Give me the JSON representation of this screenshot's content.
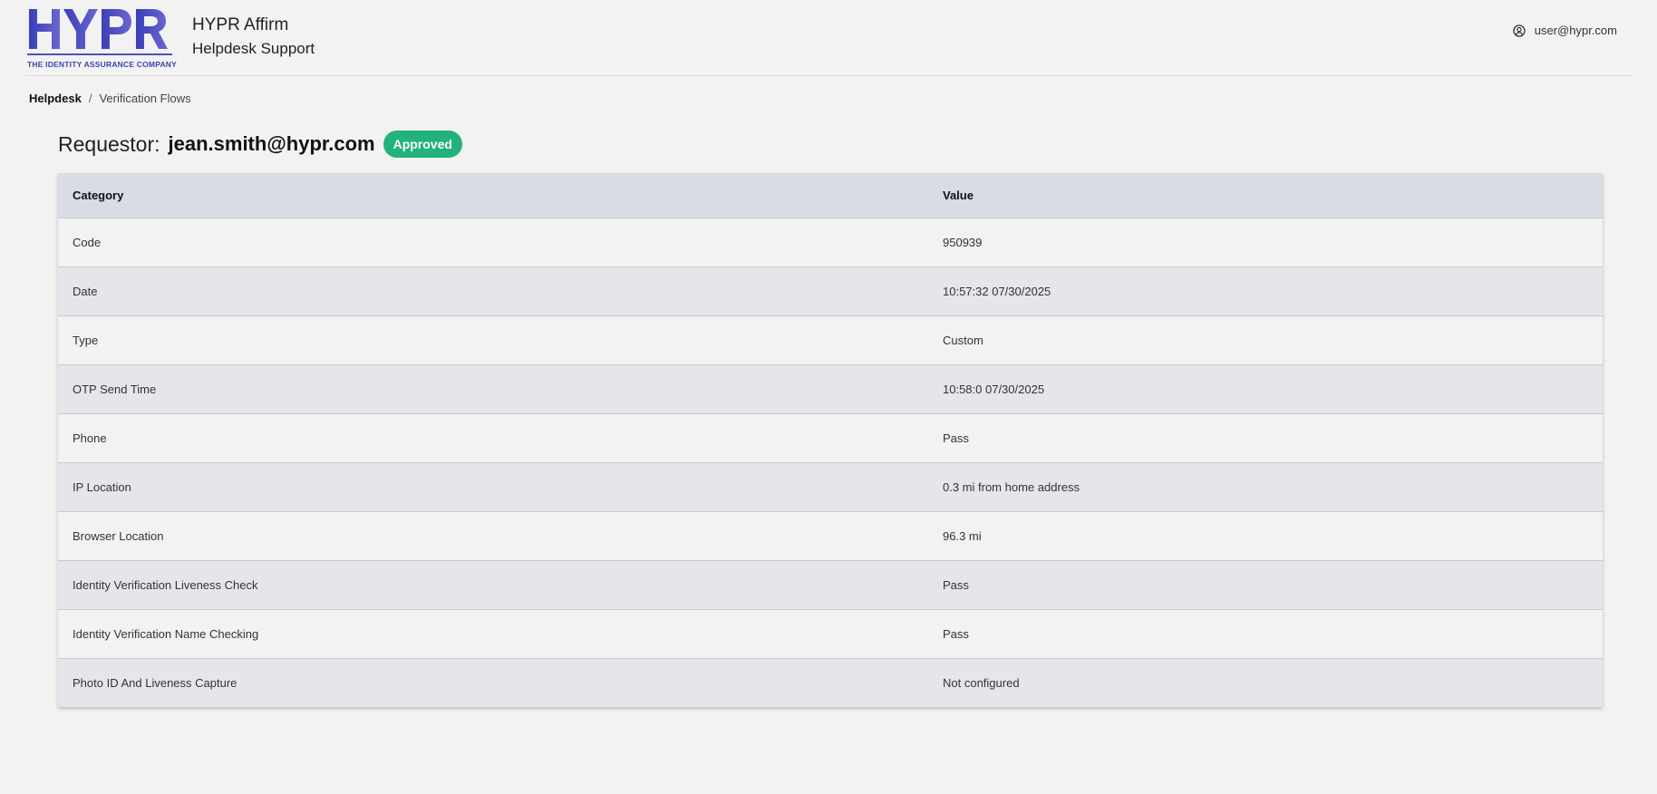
{
  "header": {
    "logo_text": "HYPR",
    "logo_tagline": "THE IDENTITY ASSURANCE COMPANY",
    "app_title": "HYPR Affirm",
    "app_subtitle": "Helpdesk Support",
    "user_email": "user@hypr.com",
    "brand_color": "#4a52c0"
  },
  "breadcrumb": {
    "home": "Helpdesk",
    "separator": "/",
    "current": "Verification Flows"
  },
  "requestor": {
    "label": "Requestor:",
    "email": "jean.smith@hypr.com",
    "status": "Approved",
    "status_color": "#23b27a"
  },
  "table": {
    "columns": [
      "Category",
      "Value"
    ],
    "rows": [
      {
        "category": "Code",
        "value": "950939"
      },
      {
        "category": "Date",
        "value": "10:57:32 07/30/2025"
      },
      {
        "category": "Type",
        "value": "Custom"
      },
      {
        "category": "OTP Send Time",
        "value": "10:58:0 07/30/2025"
      },
      {
        "category": "Phone",
        "value": "Pass"
      },
      {
        "category": "IP Location",
        "value": "0.3 mi from home address"
      },
      {
        "category": "Browser Location",
        "value": "96.3 mi"
      },
      {
        "category": "Identity Verification Liveness Check",
        "value": "Pass"
      },
      {
        "category": "Identity Verification Name Checking",
        "value": "Pass"
      },
      {
        "category": "Photo ID And Liveness Capture",
        "value": "Not configured"
      }
    ]
  }
}
